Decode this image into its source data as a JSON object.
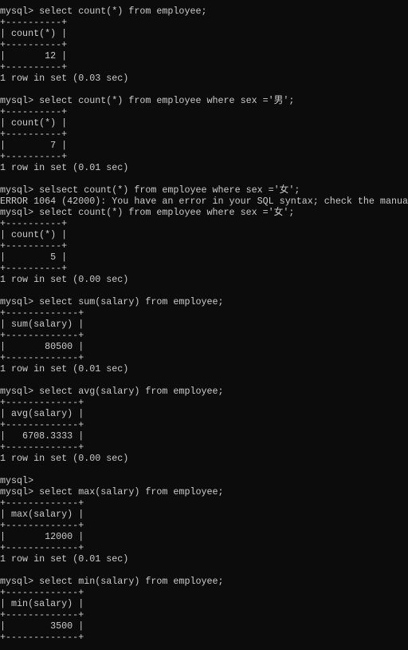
{
  "terminal": {
    "colors": {
      "background": "#0c0c0c",
      "text": "#cccccc"
    },
    "lines": [
      "mysql> select count(*) from employee;",
      "+----------+",
      "| count(*) |",
      "+----------+",
      "|       12 |",
      "+----------+",
      "1 row in set (0.03 sec)",
      "",
      "mysql> select count(*) from employee where sex ='男';",
      "+----------+",
      "| count(*) |",
      "+----------+",
      "|        7 |",
      "+----------+",
      "1 row in set (0.01 sec)",
      "",
      "mysql> selsect count(*) from employee where sex ='女';",
      "ERROR 1064 (42000): You have an error in your SQL syntax; check the manua",
      "mysql> select count(*) from employee where sex ='女';",
      "+----------+",
      "| count(*) |",
      "+----------+",
      "|        5 |",
      "+----------+",
      "1 row in set (0.00 sec)",
      "",
      "mysql> select sum(salary) from employee;",
      "+-------------+",
      "| sum(salary) |",
      "+-------------+",
      "|       80500 |",
      "+-------------+",
      "1 row in set (0.01 sec)",
      "",
      "mysql> select avg(salary) from employee;",
      "+-------------+",
      "| avg(salary) |",
      "+-------------+",
      "|   6708.3333 |",
      "+-------------+",
      "1 row in set (0.00 sec)",
      "",
      "mysql>",
      "mysql> select max(salary) from employee;",
      "+-------------+",
      "| max(salary) |",
      "+-------------+",
      "|       12000 |",
      "+-------------+",
      "1 row in set (0.01 sec)",
      "",
      "mysql> select min(salary) from employee;",
      "+-------------+",
      "| min(salary) |",
      "+-------------+",
      "|        3500 |",
      "+-------------+"
    ]
  }
}
